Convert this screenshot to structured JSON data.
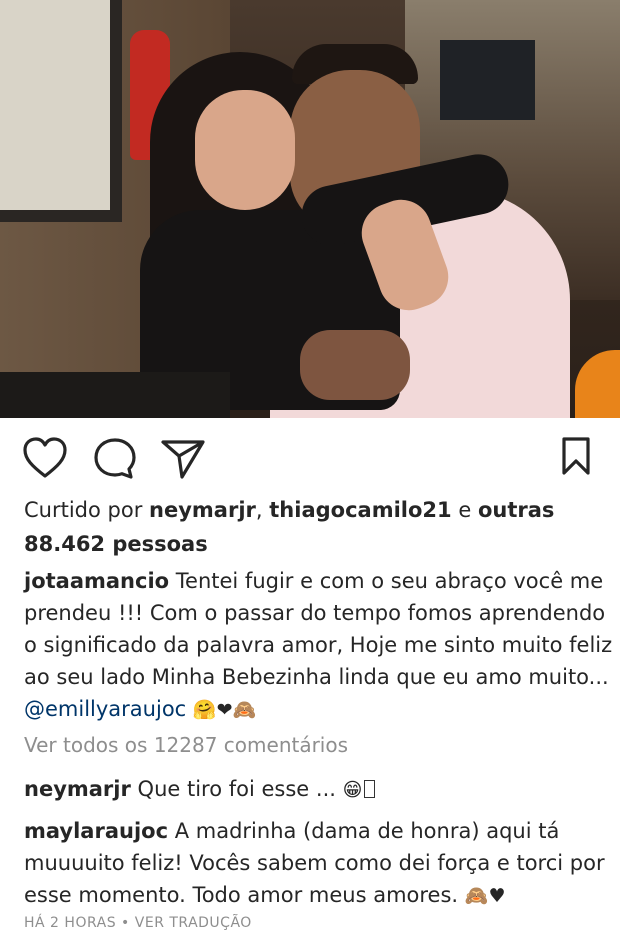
{
  "post": {
    "photo_alt": "",
    "liked_by_prefix": "Curtido por",
    "liked_user1": "neymarjr",
    "liked_sep": ",",
    "liked_user2": "thiagocamilo21",
    "liked_and": "e",
    "liked_others": "outras",
    "likes_count": "88.462 pessoas",
    "caption_user": "jotaamancio",
    "caption_text": "Tentei fugir e com o seu abraço você me prendeu !!! Com o passar do tempo fomos aprendendo o significado da palavra amor, Hoje me sinto muito feliz ao seu lado Minha Bebezinha linda que eu amo muito...",
    "caption_mention": "@emillyaraujoc",
    "caption_emojis": "🤗❤🙈",
    "view_all": "Ver todos os 12287 comentários",
    "comments": [
      {
        "user": "neymarjr",
        "text": "Que tiro foi esse ...",
        "emoji": "😁"
      },
      {
        "user": "maylaraujoc",
        "text": "A madrinha (dama de honra) aqui tá muuuuito feliz! Vocês sabem como dei força e torci por esse momento. Todo amor meus amores.",
        "emoji": "🙈♥"
      }
    ],
    "time": "HÁ 2 HORAS",
    "dot": "•",
    "translate": "VER TRADUÇÃO"
  },
  "icons": {
    "like": "heart-icon",
    "comment": "comment-bubble-icon",
    "share": "paper-plane-icon",
    "save": "bookmark-icon"
  }
}
